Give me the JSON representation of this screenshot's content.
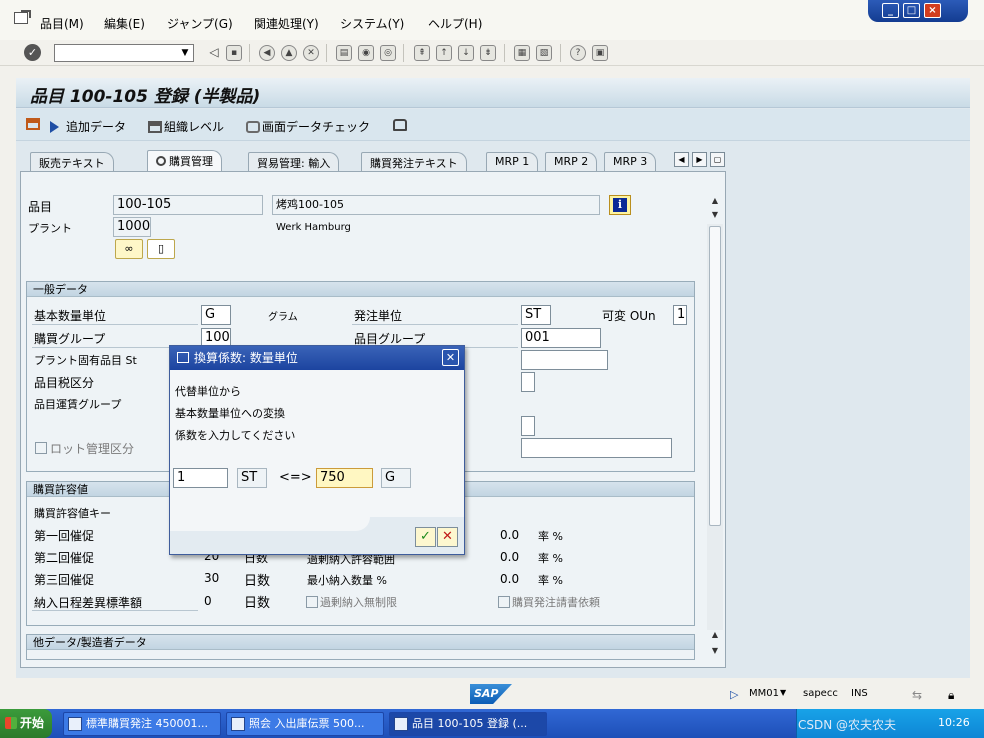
{
  "menu": {
    "items": [
      "品目(M)",
      "編集(E)",
      "ジャンプ(G)",
      "関連処理(Y)",
      "システム(Y)",
      "ヘルプ(H)"
    ]
  },
  "window_controls": {
    "minimize": "_",
    "maximize": "□",
    "close": "×"
  },
  "toolbar": {
    "command_field_value": "",
    "icons": [
      "back-icon",
      "save-icon",
      "exit-icon",
      "cancel-icon",
      "print-icon",
      "find-icon",
      "find-next-icon",
      "first-page-icon",
      "prev-page-icon",
      "next-page-icon",
      "last-page-icon",
      "new-session-icon",
      "shortcut-icon",
      "help-icon",
      "layout-icon"
    ]
  },
  "page": {
    "title": "品目 100-105 登録 (半製品)"
  },
  "app_toolbar": {
    "add_data": "追加データ",
    "org_level": "組織レベル",
    "check_data": "画面データチェック"
  },
  "tabs": [
    "販売テキスト",
    "購買管理",
    "貿易管理: 輸入",
    "購買発注テキスト",
    "MRP 1",
    "MRP 2",
    "MRP 3"
  ],
  "header": {
    "material_label": "品目",
    "material_value": "100-105",
    "material_desc": "烤鸡100-105",
    "plant_label": "プラント",
    "plant_value": "1000",
    "plant_name": "Werk Hamburg"
  },
  "general": {
    "title": "一般データ",
    "base_uom_label": "基本数量単位",
    "base_uom_value": "G",
    "base_uom_text": "グラム",
    "order_unit_label": "発注単位",
    "order_unit_value": "ST",
    "var_oun_label": "可変 OUn",
    "var_oun_value": "1",
    "purch_group_label": "購買グループ",
    "purch_group_value": "100",
    "mat_group_label": "品目グループ",
    "mat_group_value": "001",
    "plant_status_label": "プラント固有品目 St",
    "tax_label": "品目税区分",
    "freight_label": "品目運賃グループ",
    "batch_label": "ロット管理区分"
  },
  "tolerance": {
    "title": "購買許容値",
    "key_label": "購買許容値キー",
    "reminder1_label": "第一回催促",
    "reminder2_label": "第二回催促",
    "reminder2_value": "20",
    "reminder2_unit": "日数",
    "reminder3_label": "第三回催促",
    "reminder3_value": "30",
    "reminder3_unit": "日数",
    "deviation_label": "納入日程差異標準額",
    "deviation_value": "0",
    "deviation_unit": "日数",
    "over_label": "過剰納入許容範囲",
    "min_qty_label": "最小納入数量 %",
    "unlimited_label": "過剰納入無制限",
    "ack_label": "購買発注請書依頼",
    "pct1_value": "0.0",
    "pct2_value": "0.0",
    "pct3_value": "0.0",
    "rate_label": "率 %"
  },
  "other": {
    "title": "他データ/製造者データ"
  },
  "dialog": {
    "title": "換算係数: 数量単位",
    "line1": "代替単位から",
    "line2": "基本数量単位への変換",
    "line3": "係数を入力してください",
    "alt_qty": "1",
    "alt_unit": "ST",
    "equals": "<=>",
    "base_qty": "750",
    "base_unit": "G"
  },
  "status": {
    "sap": "SAP",
    "system": "MM01",
    "server": "sapecc",
    "mode": "INS"
  },
  "taskbar": {
    "start": "开始",
    "tasks": [
      "標準購買発注 450001...",
      "照会 入出庫伝票 500...",
      "品目 100-105 登録 (..."
    ],
    "clock": "10:26",
    "watermark": "CSDN @农夫农夫"
  },
  "colors": {
    "accent": "#1c44a0",
    "highlight": "#fff7c2"
  }
}
